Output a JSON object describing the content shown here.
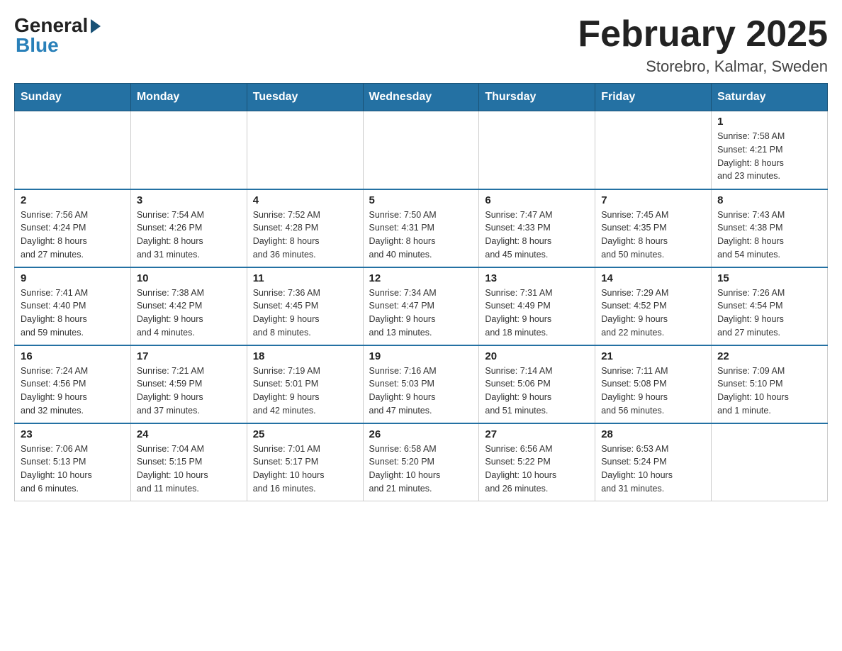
{
  "logo": {
    "general": "General",
    "blue": "Blue"
  },
  "title": "February 2025",
  "location": "Storebro, Kalmar, Sweden",
  "weekdays": [
    "Sunday",
    "Monday",
    "Tuesday",
    "Wednesday",
    "Thursday",
    "Friday",
    "Saturday"
  ],
  "weeks": [
    [
      {
        "day": "",
        "info": ""
      },
      {
        "day": "",
        "info": ""
      },
      {
        "day": "",
        "info": ""
      },
      {
        "day": "",
        "info": ""
      },
      {
        "day": "",
        "info": ""
      },
      {
        "day": "",
        "info": ""
      },
      {
        "day": "1",
        "info": "Sunrise: 7:58 AM\nSunset: 4:21 PM\nDaylight: 8 hours\nand 23 minutes."
      }
    ],
    [
      {
        "day": "2",
        "info": "Sunrise: 7:56 AM\nSunset: 4:24 PM\nDaylight: 8 hours\nand 27 minutes."
      },
      {
        "day": "3",
        "info": "Sunrise: 7:54 AM\nSunset: 4:26 PM\nDaylight: 8 hours\nand 31 minutes."
      },
      {
        "day": "4",
        "info": "Sunrise: 7:52 AM\nSunset: 4:28 PM\nDaylight: 8 hours\nand 36 minutes."
      },
      {
        "day": "5",
        "info": "Sunrise: 7:50 AM\nSunset: 4:31 PM\nDaylight: 8 hours\nand 40 minutes."
      },
      {
        "day": "6",
        "info": "Sunrise: 7:47 AM\nSunset: 4:33 PM\nDaylight: 8 hours\nand 45 minutes."
      },
      {
        "day": "7",
        "info": "Sunrise: 7:45 AM\nSunset: 4:35 PM\nDaylight: 8 hours\nand 50 minutes."
      },
      {
        "day": "8",
        "info": "Sunrise: 7:43 AM\nSunset: 4:38 PM\nDaylight: 8 hours\nand 54 minutes."
      }
    ],
    [
      {
        "day": "9",
        "info": "Sunrise: 7:41 AM\nSunset: 4:40 PM\nDaylight: 8 hours\nand 59 minutes."
      },
      {
        "day": "10",
        "info": "Sunrise: 7:38 AM\nSunset: 4:42 PM\nDaylight: 9 hours\nand 4 minutes."
      },
      {
        "day": "11",
        "info": "Sunrise: 7:36 AM\nSunset: 4:45 PM\nDaylight: 9 hours\nand 8 minutes."
      },
      {
        "day": "12",
        "info": "Sunrise: 7:34 AM\nSunset: 4:47 PM\nDaylight: 9 hours\nand 13 minutes."
      },
      {
        "day": "13",
        "info": "Sunrise: 7:31 AM\nSunset: 4:49 PM\nDaylight: 9 hours\nand 18 minutes."
      },
      {
        "day": "14",
        "info": "Sunrise: 7:29 AM\nSunset: 4:52 PM\nDaylight: 9 hours\nand 22 minutes."
      },
      {
        "day": "15",
        "info": "Sunrise: 7:26 AM\nSunset: 4:54 PM\nDaylight: 9 hours\nand 27 minutes."
      }
    ],
    [
      {
        "day": "16",
        "info": "Sunrise: 7:24 AM\nSunset: 4:56 PM\nDaylight: 9 hours\nand 32 minutes."
      },
      {
        "day": "17",
        "info": "Sunrise: 7:21 AM\nSunset: 4:59 PM\nDaylight: 9 hours\nand 37 minutes."
      },
      {
        "day": "18",
        "info": "Sunrise: 7:19 AM\nSunset: 5:01 PM\nDaylight: 9 hours\nand 42 minutes."
      },
      {
        "day": "19",
        "info": "Sunrise: 7:16 AM\nSunset: 5:03 PM\nDaylight: 9 hours\nand 47 minutes."
      },
      {
        "day": "20",
        "info": "Sunrise: 7:14 AM\nSunset: 5:06 PM\nDaylight: 9 hours\nand 51 minutes."
      },
      {
        "day": "21",
        "info": "Sunrise: 7:11 AM\nSunset: 5:08 PM\nDaylight: 9 hours\nand 56 minutes."
      },
      {
        "day": "22",
        "info": "Sunrise: 7:09 AM\nSunset: 5:10 PM\nDaylight: 10 hours\nand 1 minute."
      }
    ],
    [
      {
        "day": "23",
        "info": "Sunrise: 7:06 AM\nSunset: 5:13 PM\nDaylight: 10 hours\nand 6 minutes."
      },
      {
        "day": "24",
        "info": "Sunrise: 7:04 AM\nSunset: 5:15 PM\nDaylight: 10 hours\nand 11 minutes."
      },
      {
        "day": "25",
        "info": "Sunrise: 7:01 AM\nSunset: 5:17 PM\nDaylight: 10 hours\nand 16 minutes."
      },
      {
        "day": "26",
        "info": "Sunrise: 6:58 AM\nSunset: 5:20 PM\nDaylight: 10 hours\nand 21 minutes."
      },
      {
        "day": "27",
        "info": "Sunrise: 6:56 AM\nSunset: 5:22 PM\nDaylight: 10 hours\nand 26 minutes."
      },
      {
        "day": "28",
        "info": "Sunrise: 6:53 AM\nSunset: 5:24 PM\nDaylight: 10 hours\nand 31 minutes."
      },
      {
        "day": "",
        "info": ""
      }
    ]
  ]
}
